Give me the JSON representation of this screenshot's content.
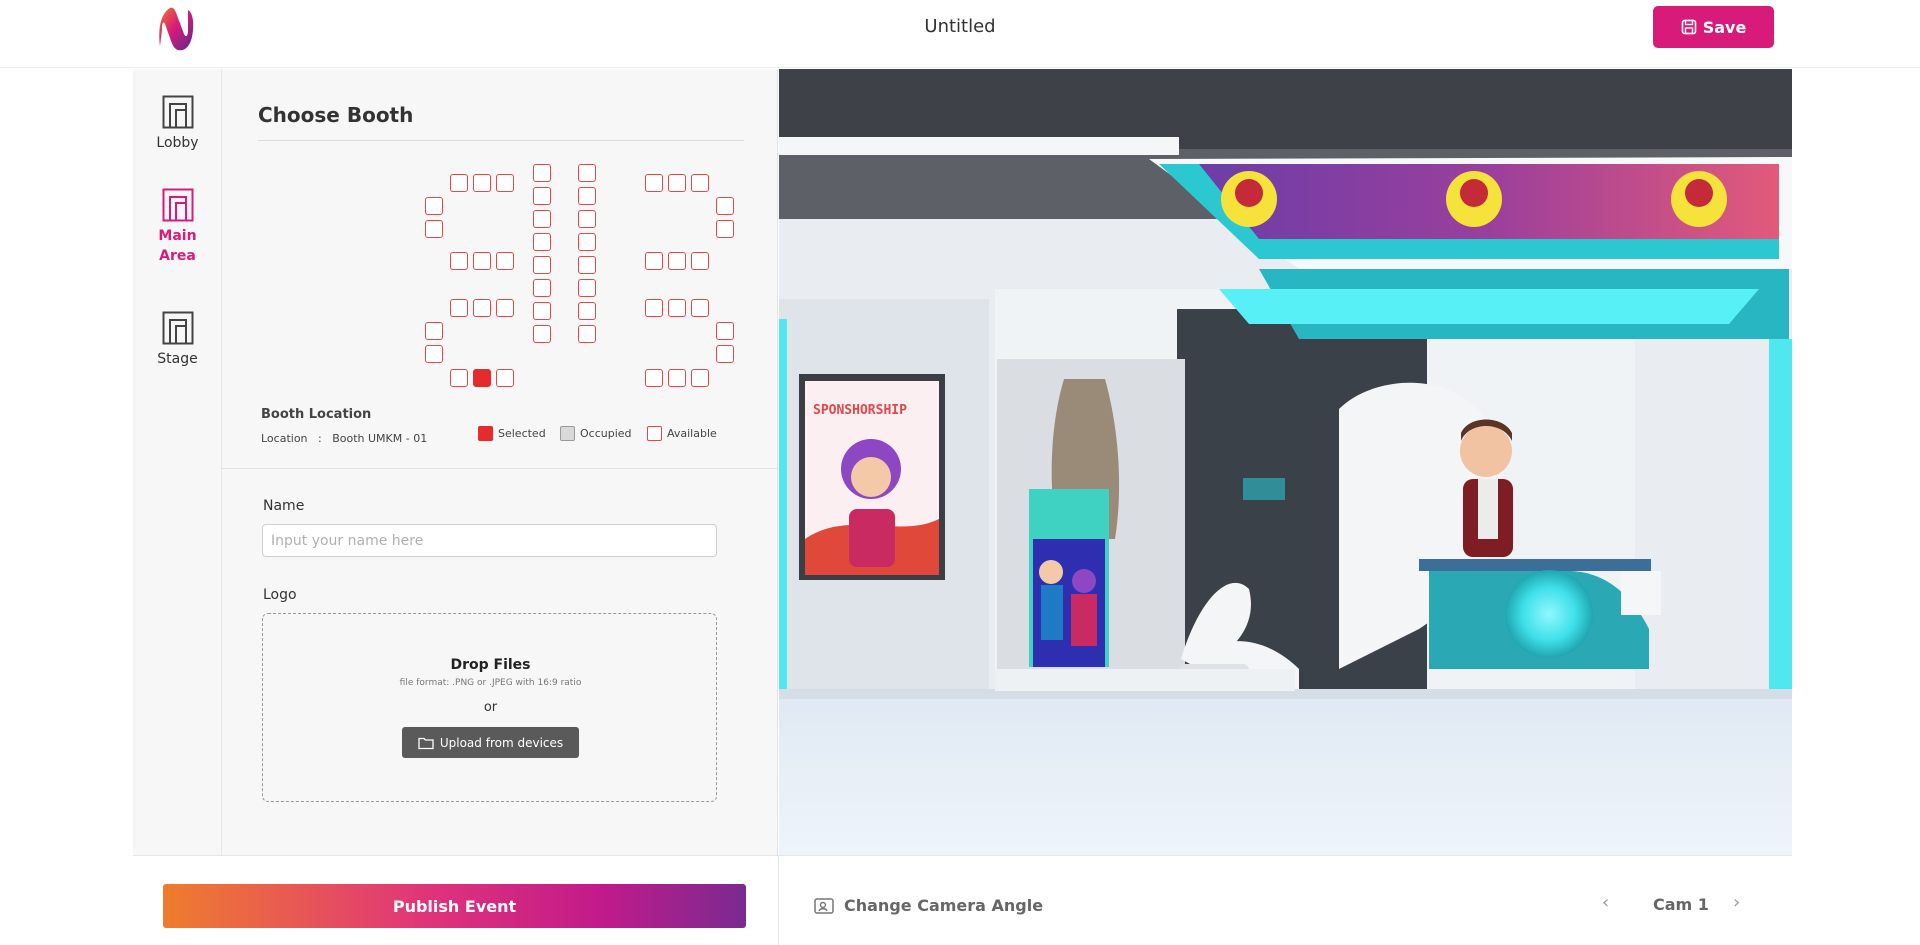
{
  "header": {
    "title": "Untitled",
    "save_label": "Save",
    "brand_color": "#d81b7a"
  },
  "nav": [
    {
      "label": "Lobby",
      "icon": "booth-icon",
      "active": false
    },
    {
      "label": "Main Area",
      "icon": "booth-icon",
      "active": true
    },
    {
      "label": "Stage",
      "icon": "booth-icon",
      "active": false
    }
  ],
  "panel": {
    "title": "Choose Booth",
    "booth_location_title": "Booth Location",
    "location_label": "Location",
    "location_value": "Booth UMKM - 01",
    "legend": {
      "selected": "Selected",
      "occupied": "Occupied",
      "available": "Available"
    },
    "legend_colors": {
      "selected": "#e52b2b",
      "occupied": "#d9d9d9",
      "available": "#e24848"
    },
    "name_label": "Name",
    "name_placeholder": "Input your name here",
    "name_value": "",
    "logo_label": "Logo",
    "drop_title": "Drop Files",
    "drop_subtitle": "file format: .PNG or .JPEG with 16:9 ratio",
    "drop_or": "or",
    "upload_label": "Upload from devices"
  },
  "scene": {
    "banner_text": "SPONSHORSHIP"
  },
  "bottom": {
    "publish_label": "Publish Event",
    "camera_angle_label": "Change Camera Angle",
    "camera_value": "Cam 1"
  }
}
